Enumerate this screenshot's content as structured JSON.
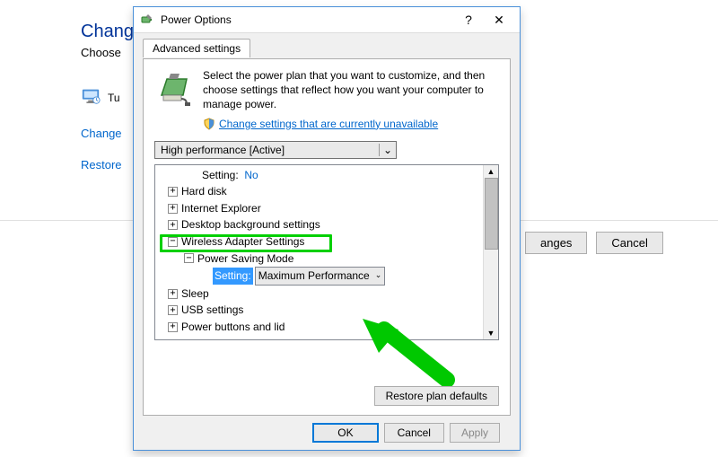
{
  "bg": {
    "heading": "Chang",
    "sub": "Choose",
    "turn": "Tu",
    "link1": "Change",
    "link2": "Restore",
    "save": "anges",
    "cancel": "Cancel"
  },
  "dialog": {
    "title": "Power Options",
    "tab": "Advanced settings",
    "intro": "Select the power plan that you want to customize, and then choose settings that reflect how you want your computer to manage power.",
    "shield_link": "Change settings that are currently unavailable",
    "plan_selected": "High performance [Active]",
    "restore": "Restore plan defaults",
    "ok": "OK",
    "cancel": "Cancel",
    "apply": "Apply"
  },
  "tree": {
    "setting_top_label": "Setting:",
    "setting_top_value": "No",
    "items": [
      "Hard disk",
      "Internet Explorer",
      "Desktop background settings",
      "Wireless Adapter Settings",
      "Sleep",
      "USB settings",
      "Power buttons and lid"
    ],
    "wireless_child": "Power Saving Mode",
    "wireless_setting_label": "Setting:",
    "wireless_setting_value": "Maximum Performance"
  }
}
